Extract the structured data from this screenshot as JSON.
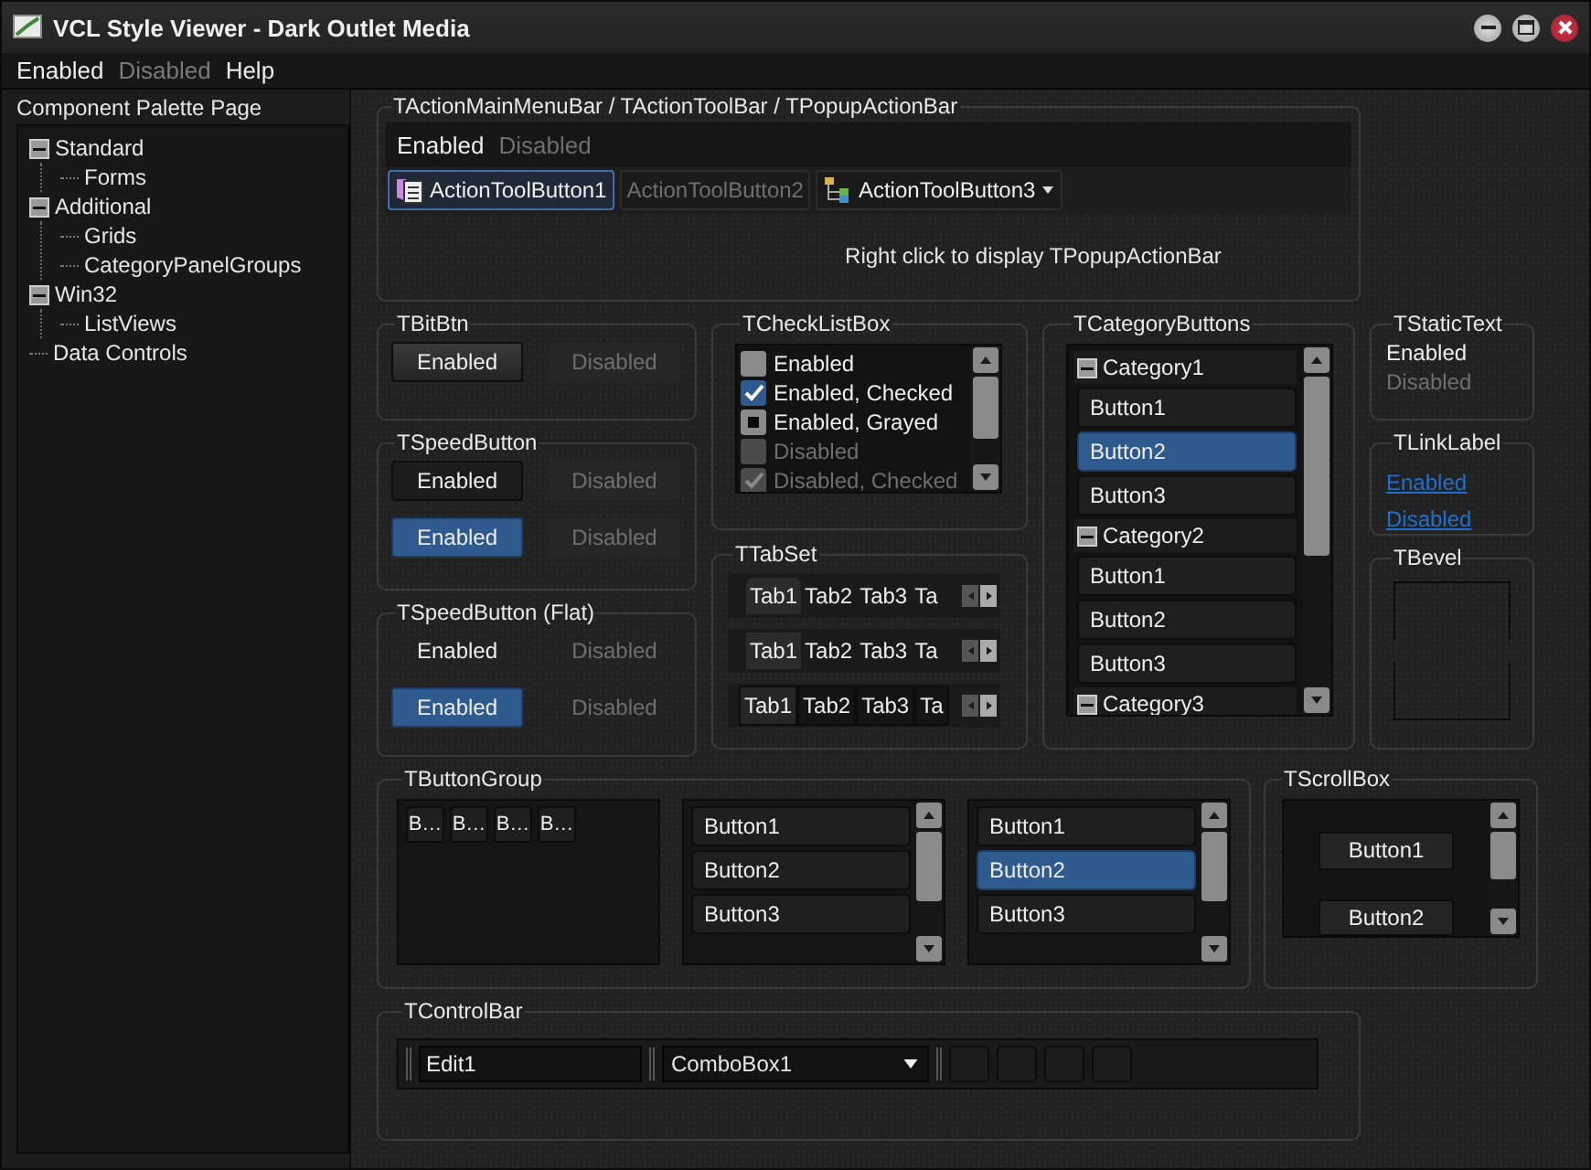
{
  "window": {
    "title": "VCL Style Viewer - Dark Outlet Media"
  },
  "menu": [
    {
      "label": "Enabled",
      "disabled": false
    },
    {
      "label": "Disabled",
      "disabled": true
    },
    {
      "label": "Help",
      "disabled": false
    }
  ],
  "sidebar": {
    "title": "Component Palette Page",
    "tree": [
      {
        "label": "Standard",
        "expanded": true,
        "children": [
          {
            "label": "Forms"
          }
        ]
      },
      {
        "label": "Additional",
        "expanded": true,
        "children": [
          {
            "label": "Grids"
          },
          {
            "label": "CategoryPanelGroups"
          }
        ]
      },
      {
        "label": "Win32",
        "expanded": true,
        "children": [
          {
            "label": "ListViews"
          }
        ]
      },
      {
        "label": "Data Controls"
      }
    ]
  },
  "action_bar": {
    "title": "TActionMainMenuBar / TActionToolBar / TPopupActionBar",
    "menu": [
      {
        "label": "Enabled",
        "disabled": false
      },
      {
        "label": "Disabled",
        "disabled": true
      }
    ],
    "tool_buttons": [
      {
        "label": "ActionToolButton1",
        "kind": "icon",
        "disabled": false,
        "selected": true
      },
      {
        "label": "ActionToolButton2",
        "kind": "text",
        "disabled": true,
        "selected": false
      },
      {
        "label": "ActionToolButton3",
        "kind": "dropdown",
        "disabled": false,
        "selected": false
      }
    ],
    "hint": "Right click to display TPopupActionBar"
  },
  "bit_btn": {
    "title": "TBitBtn",
    "buttons": [
      {
        "label": "Enabled",
        "disabled": false,
        "selected": false
      },
      {
        "label": "Disabled",
        "disabled": true,
        "selected": false
      }
    ]
  },
  "speed_button": {
    "title": "TSpeedButton",
    "buttons": [
      {
        "label": "Enabled",
        "disabled": false,
        "selected": false
      },
      {
        "label": "Disabled",
        "disabled": true,
        "selected": false
      },
      {
        "label": "Enabled",
        "disabled": false,
        "selected": true
      },
      {
        "label": "Disabled",
        "disabled": true,
        "selected": false
      }
    ]
  },
  "speed_button_flat": {
    "title": "TSpeedButton (Flat)",
    "buttons": [
      {
        "label": "Enabled",
        "disabled": false,
        "selected": false
      },
      {
        "label": "Disabled",
        "disabled": true,
        "selected": false
      },
      {
        "label": "Enabled",
        "disabled": false,
        "selected": true
      },
      {
        "label": "Disabled",
        "disabled": true,
        "selected": false
      }
    ]
  },
  "check_list_box": {
    "title": "TCheckListBox",
    "items": [
      {
        "label": "Enabled",
        "kind": "unchecked",
        "disabled": false
      },
      {
        "label": "Enabled, Checked",
        "kind": "checked",
        "disabled": false
      },
      {
        "label": "Enabled, Grayed",
        "kind": "grayed",
        "disabled": false
      },
      {
        "label": "Disabled",
        "kind": "unchecked",
        "disabled": true
      },
      {
        "label": "Disabled, Checked",
        "kind": "checked",
        "disabled": true
      }
    ]
  },
  "tab_set": {
    "title": "TTabSet",
    "strips": [
      {
        "kind": "slanted",
        "tabs": [
          {
            "label": "Tab1",
            "selected": true
          },
          {
            "label": "Tab2",
            "selected": false
          },
          {
            "label": "Tab3",
            "selected": false
          },
          {
            "label": "Ta",
            "selected": false
          }
        ]
      },
      {
        "kind": "flat",
        "tabs": [
          {
            "label": "Tab1",
            "selected": true
          },
          {
            "label": "Tab2",
            "selected": false
          },
          {
            "label": "Tab3",
            "selected": false
          },
          {
            "label": "Ta",
            "selected": false
          }
        ]
      },
      {
        "kind": "boxed",
        "tabs": [
          {
            "label": "Tab1",
            "selected": true
          },
          {
            "label": "Tab2",
            "selected": false
          },
          {
            "label": "Tab3",
            "selected": false
          },
          {
            "label": "Ta",
            "selected": false
          }
        ]
      }
    ]
  },
  "category_buttons": {
    "title": "TCategoryButtons",
    "categories": [
      {
        "label": "Category1",
        "expanded": true,
        "buttons": [
          {
            "label": "Button1",
            "selected": false
          },
          {
            "label": "Button2",
            "selected": true
          },
          {
            "label": "Button3",
            "selected": false
          }
        ]
      },
      {
        "label": "Category2",
        "expanded": true,
        "buttons": [
          {
            "label": "Button1",
            "selected": false
          },
          {
            "label": "Button2",
            "selected": false
          },
          {
            "label": "Button3",
            "selected": false
          }
        ]
      },
      {
        "label": "Category3",
        "expanded": true
      }
    ]
  },
  "static_text": {
    "title": "TStaticText",
    "items": [
      {
        "label": "Enabled",
        "disabled": false
      },
      {
        "label": "Disabled",
        "disabled": true
      }
    ]
  },
  "link_label": {
    "title": "TLinkLabel",
    "links": [
      "Enabled",
      "Disabled"
    ]
  },
  "bevel": {
    "title": "TBevel"
  },
  "button_group": {
    "title": "TButtonGroup",
    "groups": [
      {
        "kind": "compact",
        "buttons": [
          {
            "label": "B…"
          },
          {
            "label": "B…"
          },
          {
            "label": "B…"
          },
          {
            "label": "B…"
          }
        ]
      },
      {
        "kind": "list",
        "buttons": [
          {
            "label": "Button1"
          },
          {
            "label": "Button2"
          },
          {
            "label": "Button3"
          }
        ]
      },
      {
        "kind": "list",
        "buttons": [
          {
            "label": "Button1",
            "selected": false
          },
          {
            "label": "Button2",
            "selected": true
          },
          {
            "label": "Button3",
            "selected": false
          }
        ]
      }
    ]
  },
  "scroll_box": {
    "title": "TScrollBox",
    "buttons": [
      "Button1",
      "Button2"
    ]
  },
  "control_bar": {
    "title": "TControlBar",
    "edit": {
      "value": "Edit1"
    },
    "combo": {
      "value": "ComboBox1"
    }
  }
}
